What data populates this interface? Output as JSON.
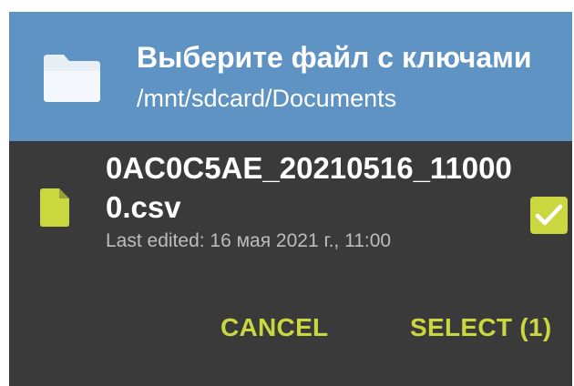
{
  "header": {
    "title": "Выберите файл с ключами",
    "path": "/mnt/sdcard/Documents",
    "icon": "folder-icon",
    "background": "#5f93c4"
  },
  "file": {
    "name": "0AC0C5AE_20210516_110000.csv",
    "meta": "Last edited: 16 мая 2021 г., 11:00",
    "icon": "file-icon",
    "checked": true
  },
  "actions": {
    "cancel_label": "CANCEL",
    "select_label": "SELECT (1)"
  },
  "colors": {
    "accent": "#cbd73f",
    "dialog_background": "#3a3a3a"
  }
}
